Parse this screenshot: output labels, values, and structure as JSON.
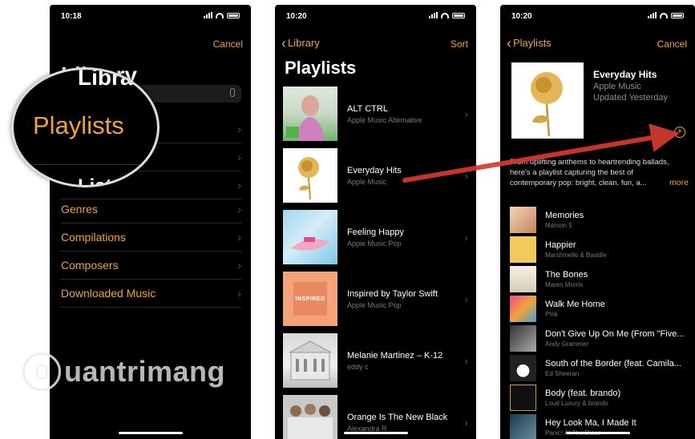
{
  "phone1": {
    "time": "10:18",
    "cancel": "Cancel",
    "library_title_partial": "Library",
    "magnified_item": "Playlists",
    "list_partial": "List",
    "items": [
      {
        "label": "Genres"
      },
      {
        "label": "Compilations"
      },
      {
        "label": "Composers"
      },
      {
        "label": "Downloaded Music"
      }
    ]
  },
  "phone2": {
    "time": "10:20",
    "back": "Library",
    "sort": "Sort",
    "title": "Playlists",
    "playlists": [
      {
        "name": "ALT CTRL",
        "sub": "Apple Music Alternative"
      },
      {
        "name": "Everyday Hits",
        "sub": "Apple Music"
      },
      {
        "name": "Feeling Happy",
        "sub": "Apple Music Pop"
      },
      {
        "name": "Inspired by Taylor Swift",
        "sub": "Apple Music Pop",
        "art_label": "INSPIRED"
      },
      {
        "name": "Melanie Martinez – K-12",
        "sub": "eddy c"
      },
      {
        "name": "Orange Is The New Black",
        "sub": "Alexandra R"
      }
    ]
  },
  "phone3": {
    "time": "10:20",
    "back": "Playlists",
    "cancel": "Cancel",
    "title": "Everyday Hits",
    "curator": "Apple Music",
    "updated": "Updated Yesterday",
    "description": "From uplifting anthems to heartrending ballads, here's a playlist capturing the best of contemporary pop: bright, clean, fun, a...",
    "more": "more",
    "songs": [
      {
        "name": "Memories",
        "artist": "Maroon 5"
      },
      {
        "name": "Happier",
        "artist": "Marshmello & Bastille"
      },
      {
        "name": "The Bones",
        "artist": "Maren Morris"
      },
      {
        "name": "Walk Me Home",
        "artist": "P!nk"
      },
      {
        "name": "Don't Give Up On Me (From \"Five...",
        "artist": "Andy Grammer"
      },
      {
        "name": "South of the Border (feat. Camila...",
        "artist": "Ed Sheeran"
      },
      {
        "name": "Body (feat. brando)",
        "artist": "Loud Luxury & brando"
      },
      {
        "name": "Hey Look Ma, I Made It",
        "artist": "Panic! At The Disco"
      }
    ]
  },
  "watermark": "uantrimang",
  "colors": {
    "accent": "#f0a33a",
    "arrow": "#d63a2f"
  }
}
